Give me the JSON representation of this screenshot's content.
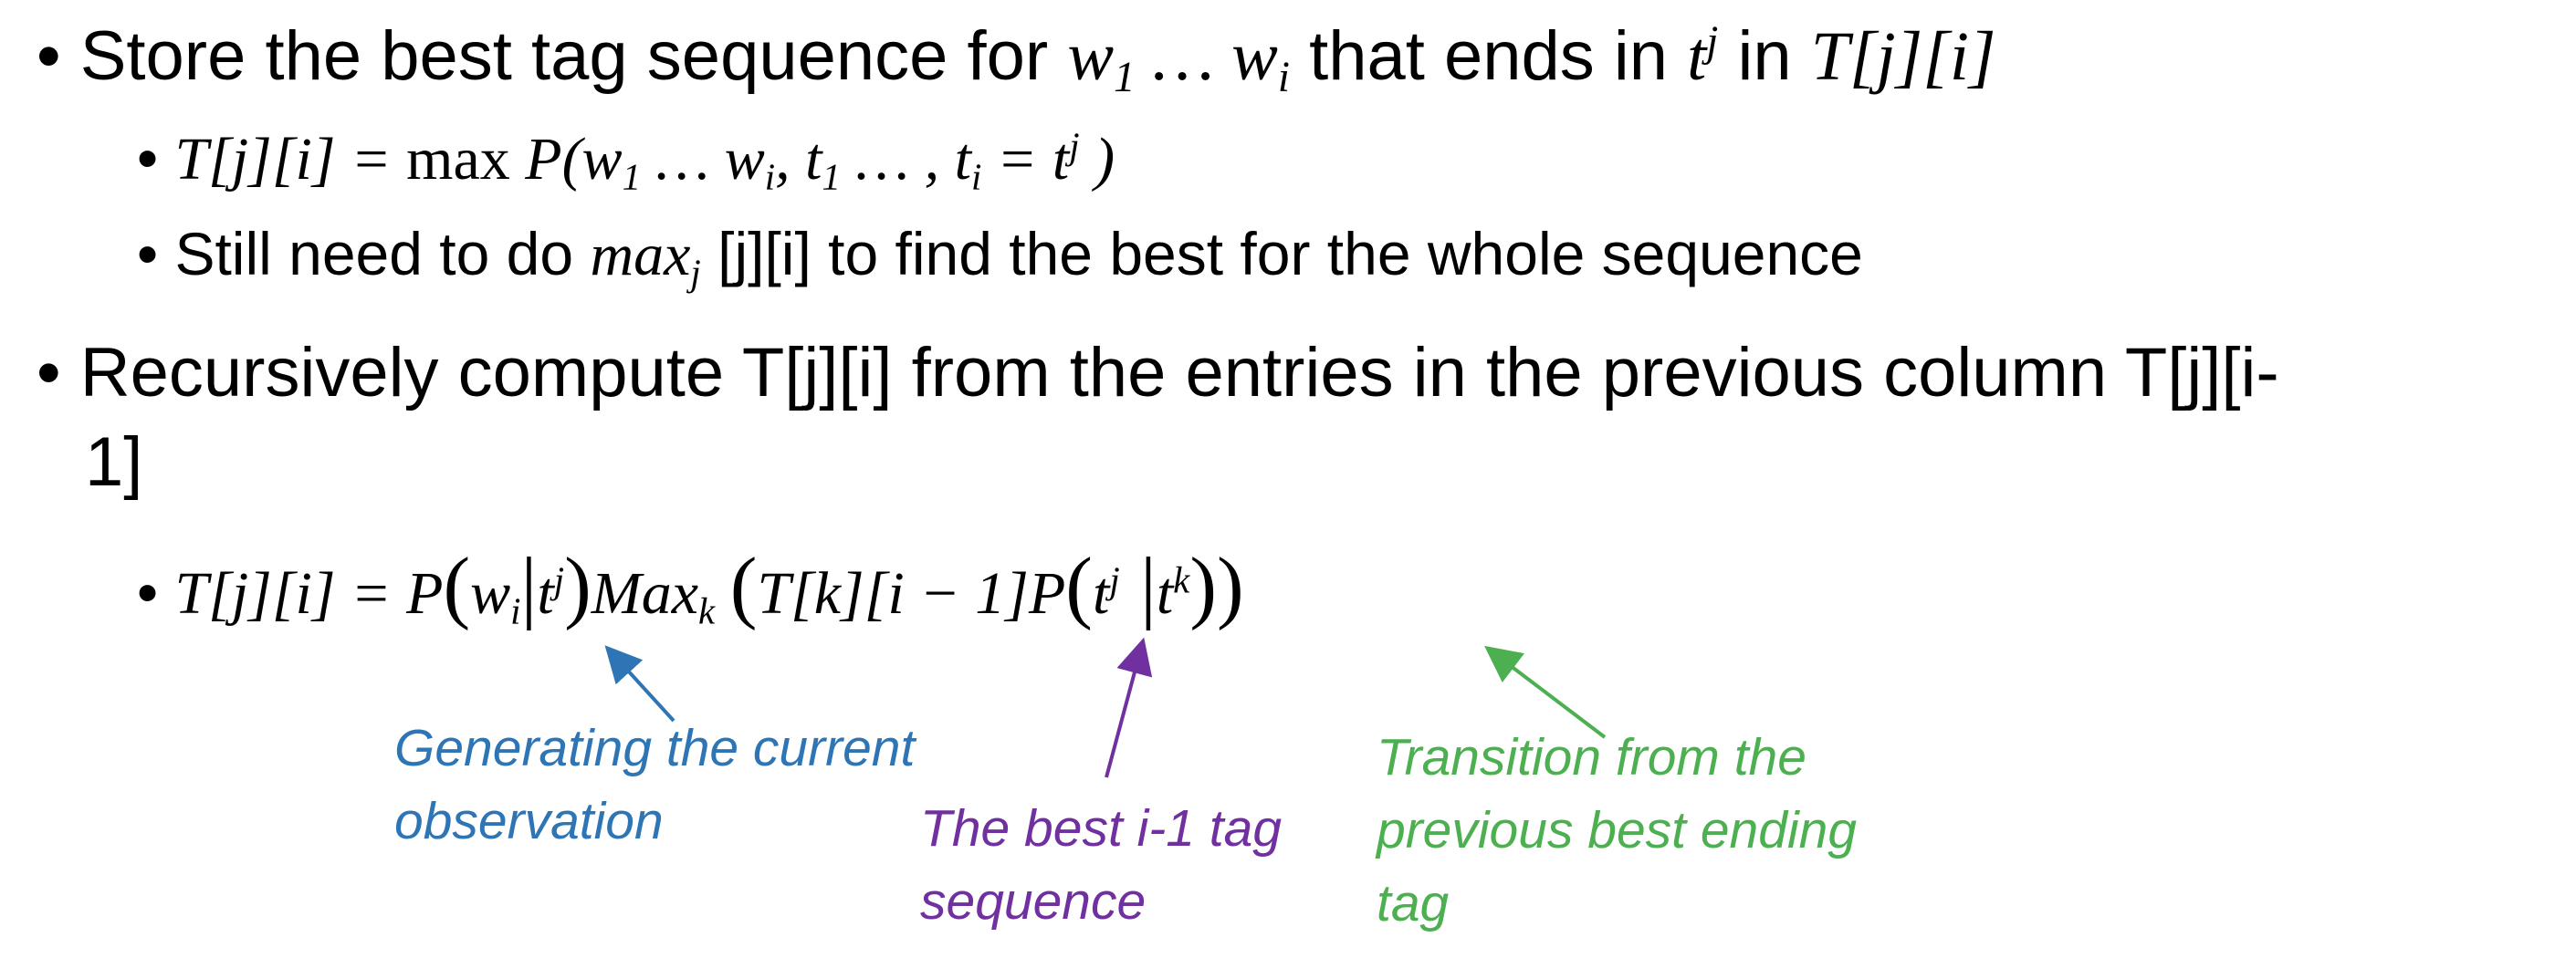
{
  "bullets": {
    "b1": {
      "text_a": "Store the best tag sequence for ",
      "w": "w",
      "sub1": "1",
      "dots": " … ",
      "wi": "w",
      "subi": "i",
      "text_b": " that ends in ",
      "t": "t",
      "supj": "j",
      "text_c": " in ",
      "T": "T[j][i]"
    },
    "b1a": {
      "lhs": "T[j][i] = ",
      "max": "max ",
      "p_open": "P(w",
      "sub1": "1",
      "mid": " … w",
      "subi": "i",
      "comma": ", t",
      "tsub1": "1",
      "dots2": " … , t",
      "tsubi": "i",
      "eq": " = t",
      "supj": "j",
      "close": " )"
    },
    "b1b": {
      "text_a": "Still need to do ",
      "max": "max",
      "subj": "j",
      "text_b": " [j][i] to find the best for the whole sequence"
    },
    "b2": {
      "line1": "Recursively compute T[j][i] from the entries in the previous column T[j][i-",
      "line2": "1]"
    },
    "b2a": {
      "lhs": "T[j][i] = P",
      "lp1": "(",
      "w": "w",
      "subi": "i",
      "bar": "|",
      "t": "t",
      "supj": "j",
      "rp1": ")",
      "maxk": "Max",
      "subk": "k",
      "lp2": "(",
      "inner": "T[k][i − 1]P",
      "lp3": "(",
      "t2": "t",
      "supj2": "j",
      "bar2": " |",
      "t3": "t",
      "supk": "k",
      "rp3": ")",
      "rp2": ")"
    }
  },
  "annotations": {
    "blue": [
      "Generating the current",
      "observation"
    ],
    "purple": [
      "The best i-1 tag",
      "sequence"
    ],
    "green": [
      "Transition from the",
      "previous best ending",
      "tag"
    ]
  },
  "colors": {
    "blue": "#2e75b6",
    "purple": "#7030a0",
    "green": "#4caf50"
  }
}
